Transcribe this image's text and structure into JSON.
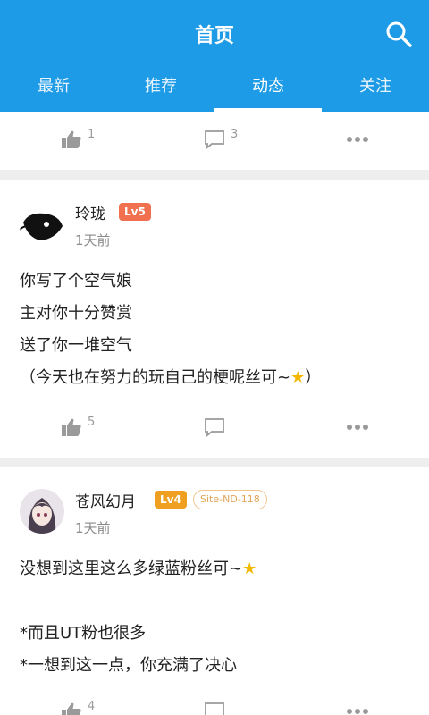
{
  "header": {
    "title": "首页",
    "tabs": [
      {
        "label": "最新"
      },
      {
        "label": "推荐"
      },
      {
        "label": "动态"
      },
      {
        "label": "关注"
      }
    ],
    "active_tab": "动态"
  },
  "posts": [
    {
      "likes": "1",
      "comments": "3"
    },
    {
      "author": "玲珑",
      "level": "Lv5",
      "level_color": "#f0704f",
      "time": "1天前",
      "lines": [
        "你写了个空气娘",
        "主对你十分赞赏",
        "送了你一堆空气",
        "（今天也在努力的玩自己的梗呢丝可~"
      ],
      "line_end": "）",
      "likes": "5",
      "comments": ""
    },
    {
      "author": "苍风幻月",
      "level": "Lv4",
      "level_color": "#f0a020",
      "badge": "Site-ND-118",
      "time": "1天前",
      "lines": [
        "没想到这里这么多绿蓝粉丝可~",
        "",
        "*而且UT粉也很多",
        "*一想到这一点，你充满了决心"
      ],
      "likes": "4",
      "comments": ""
    }
  ],
  "colors": {
    "primary": "#1e9be6",
    "star": "#f5b800"
  }
}
